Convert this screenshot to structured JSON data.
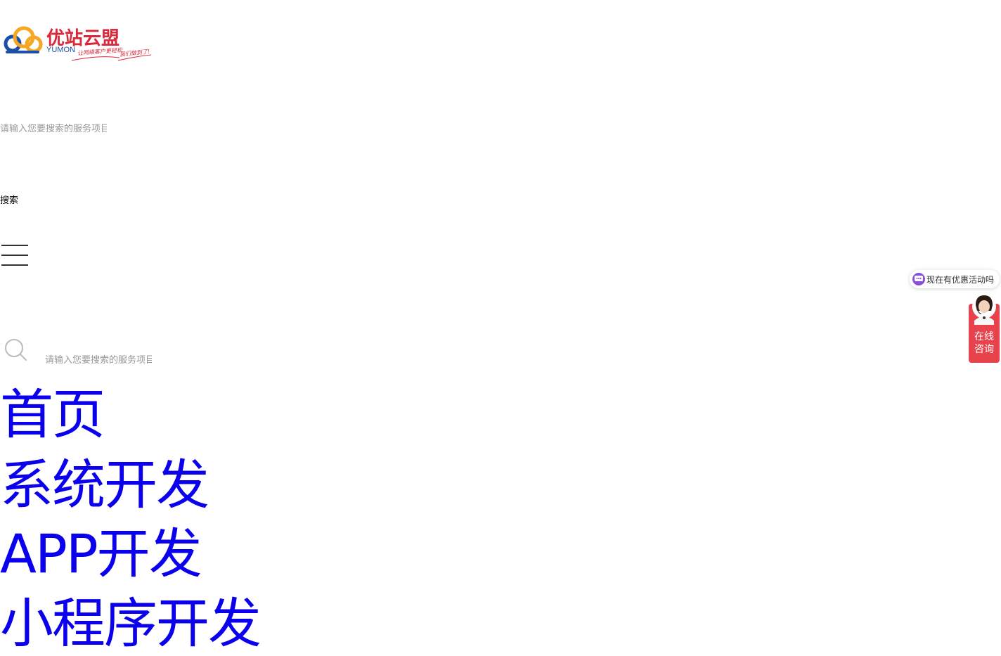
{
  "logo": {
    "brand_cn": "优站云盟",
    "brand_en": "YUMON",
    "slogan_1": "让网络客户更轻松",
    "slogan_2": "我们做到了!"
  },
  "header_search": {
    "placeholder": "请输入您要搜索的服务项目",
    "button_label": "搜索"
  },
  "mobile_search": {
    "placeholder": "请输入您要搜索的服务项目"
  },
  "nav": {
    "items": [
      {
        "label": "首页"
      },
      {
        "label": "系统开发"
      },
      {
        "label": "APP开发"
      },
      {
        "label": "小程序开发"
      }
    ]
  },
  "chat": {
    "bubble_text": "现在有优惠活动吗"
  },
  "consult": {
    "line1": "在线",
    "line2": "咨询"
  },
  "colors": {
    "link": "#0a00ee",
    "brand_red": "#d8283a",
    "brand_blue": "#1d4fa8",
    "consult_bg": "#e8424d",
    "chat_icon": "#8a4fd8"
  },
  "icons": [
    "cloud-logo-icon",
    "menu-icon",
    "search-icon",
    "chat-icon",
    "customer-service-avatar-icon"
  ]
}
